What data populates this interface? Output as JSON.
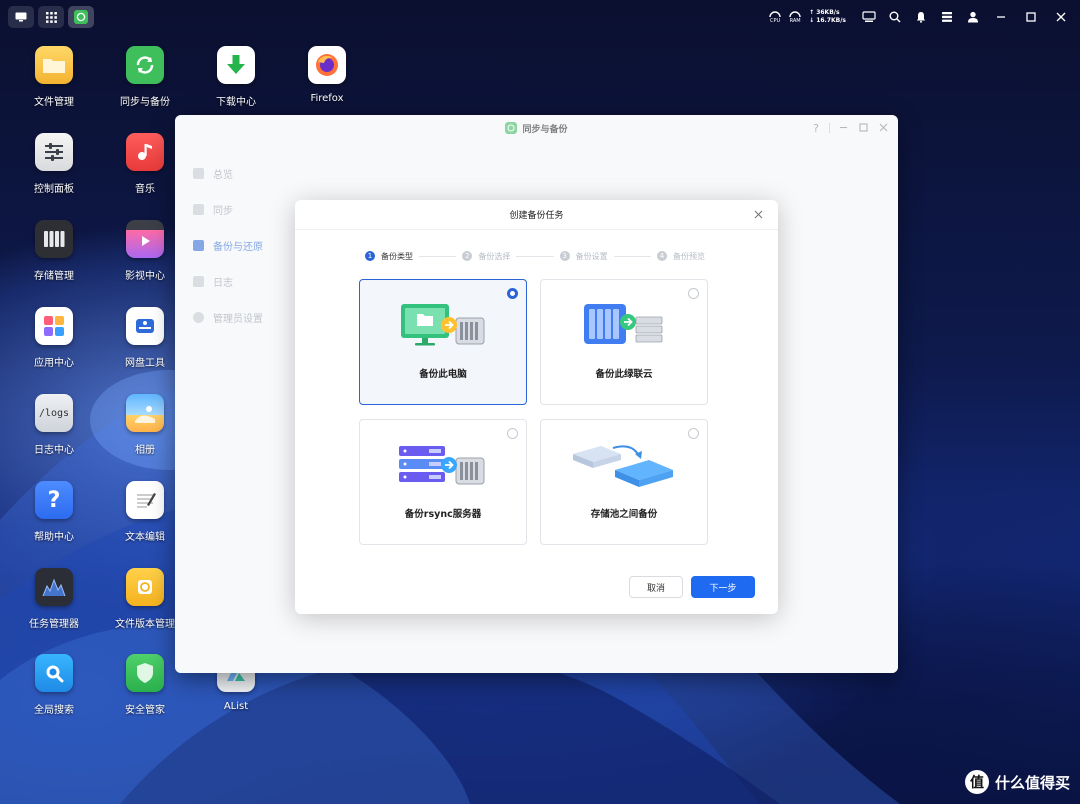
{
  "topbar": {
    "cpu_label": "CPU",
    "ram_label": "RAM",
    "net_up": "↑ 36KB/s",
    "net_down": "↓ 16.7KB/s"
  },
  "desktop": {
    "icons": [
      {
        "label": "文件管理",
        "icon": "folder-icon"
      },
      {
        "label": "同步与备份",
        "icon": "sync-icon"
      },
      {
        "label": "下载中心",
        "icon": "download-icon"
      },
      {
        "label": "Firefox",
        "icon": "firefox-icon"
      },
      {
        "label": "控制面板",
        "icon": "control-panel-icon"
      },
      {
        "label": "音乐",
        "icon": "music-icon"
      },
      {
        "label": "存储管理",
        "icon": "storage-icon"
      },
      {
        "label": "影视中心",
        "icon": "video-icon"
      },
      {
        "label": "应用中心",
        "icon": "app-center-icon"
      },
      {
        "label": "网盘工具",
        "icon": "cloud-drive-icon"
      },
      {
        "label": "日志中心",
        "icon": "logs-icon",
        "glyph": "/logs"
      },
      {
        "label": "相册",
        "icon": "photo-icon"
      },
      {
        "label": "帮助中心",
        "icon": "help-icon",
        "glyph": "?"
      },
      {
        "label": "文本编辑",
        "icon": "text-editor-icon"
      },
      {
        "label": "任务管理器",
        "icon": "task-manager-icon"
      },
      {
        "label": "文件版本管理",
        "icon": "file-version-icon"
      },
      {
        "label": "全局搜索",
        "icon": "search-icon"
      },
      {
        "label": "安全管家",
        "icon": "security-icon"
      },
      {
        "label": "AList",
        "icon": "alist-icon"
      }
    ]
  },
  "window": {
    "title": "同步与备份",
    "help": "?",
    "sidebar": [
      {
        "label": "总览"
      },
      {
        "label": "同步"
      },
      {
        "label": "备份与还原",
        "active": true
      },
      {
        "label": "日志"
      },
      {
        "label": "管理员设置"
      }
    ]
  },
  "modal": {
    "title": "创建备份任务",
    "steps": [
      {
        "num": "1",
        "label": "备份类型"
      },
      {
        "num": "2",
        "label": "备份选择"
      },
      {
        "num": "3",
        "label": "备份设置"
      },
      {
        "num": "4",
        "label": "备份预览"
      }
    ],
    "options": [
      {
        "label": "备份此电脑",
        "selected": true
      },
      {
        "label": "备份此绿联云"
      },
      {
        "label": "备份rsync服务器"
      },
      {
        "label": "存储池之间备份"
      }
    ],
    "cancel_label": "取消",
    "next_label": "下一步"
  },
  "watermark": {
    "badge": "值",
    "text": "什么值得买"
  },
  "colors": {
    "accent": "#1e6af0",
    "sync_green": "#3fbf5c"
  }
}
